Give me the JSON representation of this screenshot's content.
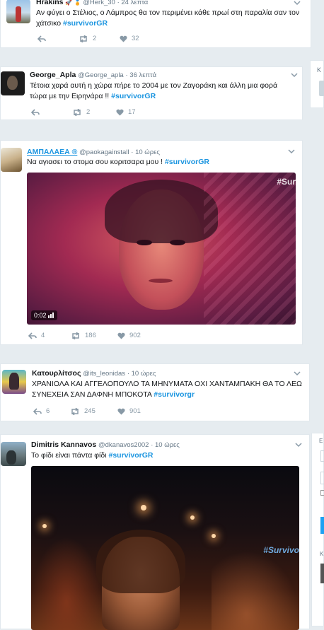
{
  "tweets": [
    {
      "name": "Hrakins",
      "badges": "🚀 🏅",
      "handle": "@Herk_30",
      "time": "· 24 λεπτά",
      "text": "Αν φύγει ο Στέλιος, ο Λάμπρος θα τον περιμένει κάθε πρωί στη παραλία σαν τον χάτσικο",
      "hashtag": "#survivorGR",
      "retweets": "2",
      "likes": "32"
    },
    {
      "name": "George_Apla",
      "handle": "@George_apla",
      "time": "· 36 λεπτά",
      "text": "Τέτοια χαρά αυτή η χώρα πήρε το 2004 με τον Ζαγοράκη και άλλη μια φορά τώρα με την Ειρηνάρα !!",
      "hashtag": "#survivorGR",
      "retweets": "2",
      "likes": "17"
    },
    {
      "name": "ΑΜΠΑΛΑΕΑ ®",
      "handle": "@paokagainstall",
      "time": "· 10 ώρες",
      "text": "Να αγιασει το στομα σου κοριτσαρα μου !",
      "hashtag": "#survivorGR",
      "video_duration": "0:02",
      "watermark": "#Sur",
      "replies": "4",
      "retweets": "186",
      "likes": "902"
    },
    {
      "name": "Κατουρλίτσος",
      "handle": "@its_leonidas",
      "time": "· 10 ώρες",
      "text": "ΧΡΑΝΙΟΛΑ ΚΑΙ ΑΓΓΕΛΟΠΟΥΛΟ ΤΑ ΜΗΝΥΜΑΤΑ ΟΧΙ ΧΑΝΤΑΜΠΑΚΗ ΘΑ ΤΟ ΛΕΩ ΣΥΝΕΧΕΙΑ ΣΑΝ ΔΑΦΝΗ ΜΠΟΚΟΤΑ",
      "hashtag": "#survivorgr",
      "replies": "6",
      "retweets": "245",
      "likes": "901"
    },
    {
      "name": "Dimitris Kannavos",
      "handle": "@dkanavos2002",
      "time": "· 10 ώρες",
      "text": "Το φίδι είναι πάντα φίδι",
      "hashtag": "#survivorGR",
      "watermark": "#Survivo"
    }
  ],
  "colors": {
    "background": "#e6ecf0",
    "hashtag": "#1b95e0",
    "muted": "#657786",
    "action": "#8899a6"
  },
  "icons": [
    "reply-icon",
    "retweet-icon",
    "heart-icon",
    "caret-down-icon",
    "volume-icon"
  ]
}
